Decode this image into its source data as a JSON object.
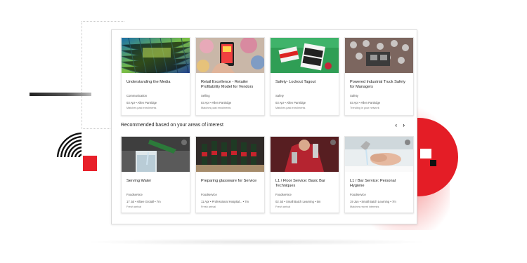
{
  "top_cards": [
    {
      "title": "Understanding the Media",
      "category": "Communication",
      "meta": "03 Apr • Allen Partridge",
      "status": "Matches past enrolments",
      "thumb": "mosaic"
    },
    {
      "title": "Retail Excellence - Retailer Profitability Model for Vendors",
      "category": "Selling",
      "meta": "03 Apr • Allen Partridge",
      "status": "Matches past enrolments",
      "thumb": "phone"
    },
    {
      "title": "Safety- Lockout Tagout",
      "category": "Safety",
      "meta": "03 Apr • Allen Partridge",
      "status": "Matches past enrolments",
      "thumb": "tagout"
    },
    {
      "title": "Powered Industrial Truck Safety for Managers",
      "category": "Safety",
      "meta": "03 Apr • Allen Partridge",
      "status": "Trending in your network",
      "thumb": "truck"
    }
  ],
  "section": {
    "title": "Recommended based on your areas of interest",
    "prev": "‹",
    "next": "›"
  },
  "bottom_cards": [
    {
      "title": "Serving Water",
      "category": "Foodservice",
      "meta": "17 Jul • Albee Grotall • 7m",
      "status": "Fresh arrival",
      "thumb": "water"
    },
    {
      "title": "Preparing glassware for Service",
      "category": "Foodservice",
      "meta": "11 Apr • Professional Hospital... • 7m",
      "status": "Fresh arrival",
      "thumb": "glasses"
    },
    {
      "title": "L1 / Floor Service: Basic Bar Techniques",
      "category": "Foodservice",
      "meta": "02 Jul • Small Batch Learning • 5m",
      "status": "Fresh arrival",
      "thumb": "bar"
    },
    {
      "title": "L1 / Bar Service: Personal Hygiene",
      "category": "Foodservice",
      "meta": "19 Jun • Small Batch Learning • 7m",
      "status": "Matches recent interests",
      "thumb": "hands"
    }
  ],
  "colors": {
    "accent": "#e41d26",
    "text": "#222222",
    "muted": "#555555"
  }
}
